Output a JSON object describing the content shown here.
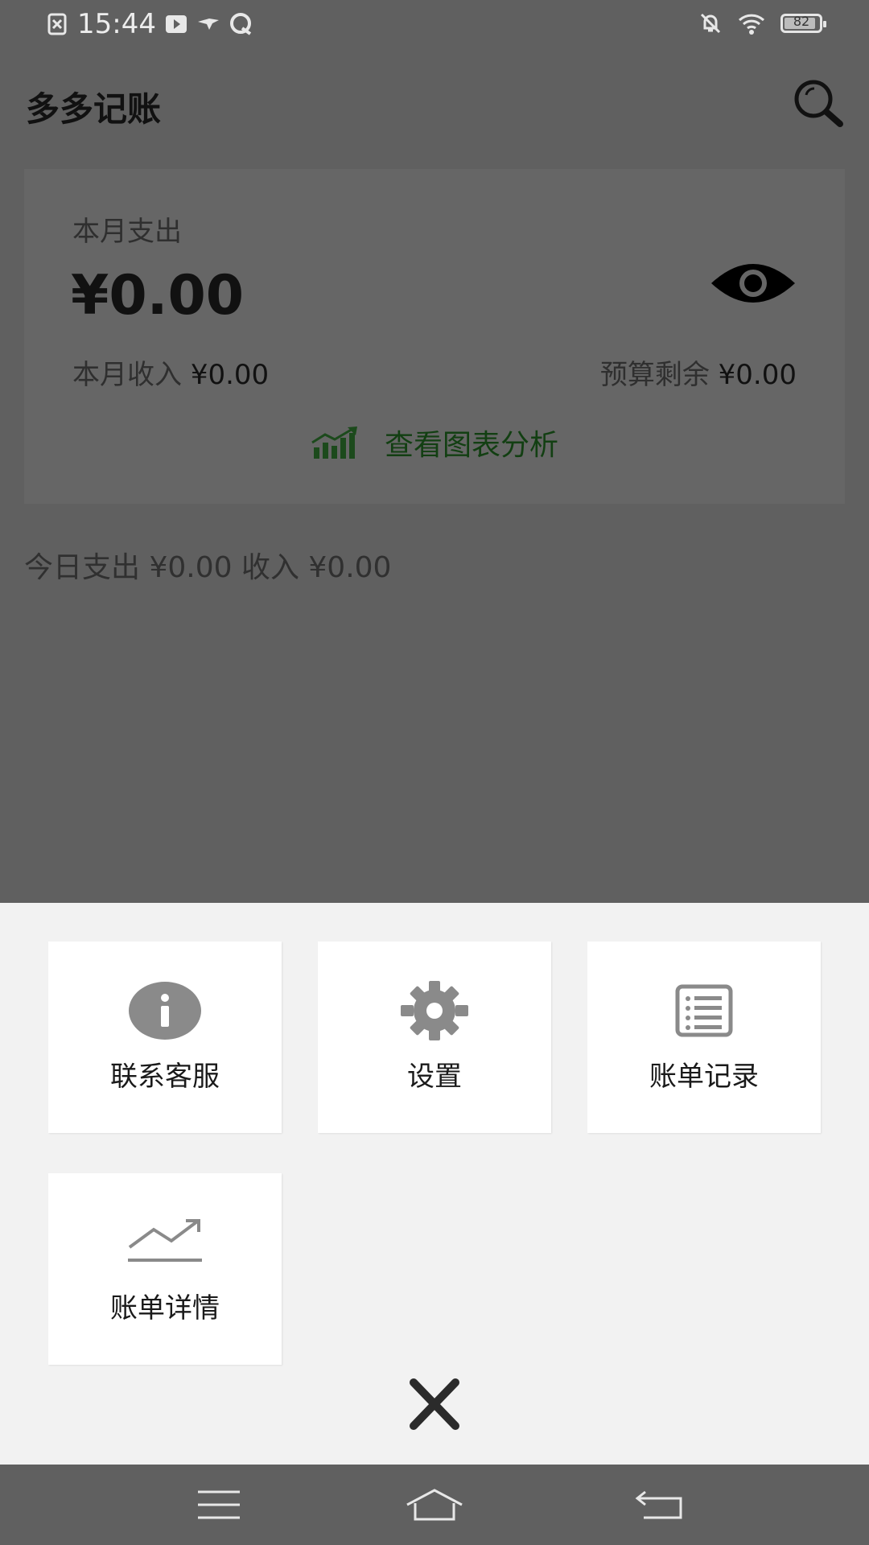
{
  "status_bar": {
    "time": "15:44",
    "battery": "82",
    "icons": [
      "close-box-icon",
      "play-icon",
      "bird-icon",
      "chat-icon",
      "bell-off-icon",
      "wifi-icon",
      "battery-icon"
    ]
  },
  "app_bar": {
    "title": "多多记账",
    "search_icon": "search-icon"
  },
  "summary": {
    "month_expense_label": "本月支出",
    "month_expense_value": "¥0.00",
    "month_income_label": "本月收入",
    "month_income_value": "¥0.00",
    "budget_label": "预算剩余",
    "budget_value": "¥0.00",
    "chart_link_label": "查看图表分析",
    "eye_icon": "eye-icon"
  },
  "today": {
    "text": "今日支出 ¥0.00 收入 ¥0.00"
  },
  "menu": {
    "items": [
      {
        "label": "联系客服",
        "icon": "info-icon"
      },
      {
        "label": "设置",
        "icon": "gear-icon"
      },
      {
        "label": "账单记录",
        "icon": "list-icon"
      },
      {
        "label": "账单详情",
        "icon": "trend-icon"
      }
    ],
    "close_icon": "close-icon"
  },
  "nav_bar": {
    "icons": [
      "menu-icon",
      "home-icon",
      "back-icon"
    ]
  },
  "colors": {
    "overlay_bg": "#606060",
    "sheet_bg": "#f2f2f2",
    "tile_bg": "#ffffff",
    "chart_link": "#123f12",
    "icon_gray": "#8a8a8a"
  }
}
